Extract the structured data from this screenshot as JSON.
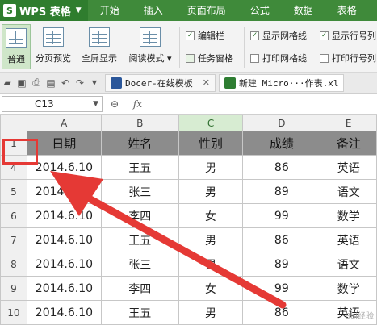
{
  "app": {
    "name": "WPS 表格",
    "logo": "S"
  },
  "menu": [
    "开始",
    "插入",
    "页面布局",
    "公式",
    "数据",
    "表格"
  ],
  "ribbon": {
    "buttons": [
      "普通",
      "分页预览",
      "全屏显示",
      "阅读模式"
    ],
    "reading_mode_arrow": "▾",
    "checkboxes": [
      {
        "label": "编辑栏",
        "checked": true
      },
      {
        "label": "任务窗格",
        "checked": false
      },
      {
        "label": "显示网格线",
        "checked": true
      },
      {
        "label": "打印网格线",
        "checked": false
      },
      {
        "label": "显示行号列",
        "checked": true
      },
      {
        "label": "打印行号列",
        "checked": false
      }
    ]
  },
  "tabs": [
    {
      "label": "Docer-在线模板",
      "icon_color": "#2b579a"
    },
    {
      "label": "新建 Micro···作表.xl",
      "icon_color": "#2e7d32"
    }
  ],
  "formula_bar": {
    "cell_ref": "C13",
    "fx": "fx"
  },
  "columns": [
    "A",
    "B",
    "C",
    "D",
    "E"
  ],
  "selected_column": "C",
  "header_row": {
    "row_num": "1",
    "cells": [
      "日期",
      "姓名",
      "性别",
      "成绩",
      "备注"
    ]
  },
  "rows": [
    {
      "num": "4",
      "cells": [
        "2014.6.10",
        "王五",
        "男",
        "86",
        "英语"
      ]
    },
    {
      "num": "5",
      "cells": [
        "2014.6.10",
        "张三",
        "男",
        "89",
        "语文"
      ]
    },
    {
      "num": "6",
      "cells": [
        "2014.6.10",
        "李四",
        "女",
        "99",
        "数学"
      ]
    },
    {
      "num": "7",
      "cells": [
        "2014.6.10",
        "王五",
        "男",
        "86",
        "英语"
      ]
    },
    {
      "num": "8",
      "cells": [
        "2014.6.10",
        "张三",
        "男",
        "89",
        "语文"
      ]
    },
    {
      "num": "9",
      "cells": [
        "2014.6.10",
        "李四",
        "女",
        "99",
        "数学"
      ]
    },
    {
      "num": "10",
      "cells": [
        "2014.6.10",
        "王五",
        "男",
        "86",
        "英语"
      ]
    }
  ],
  "watermark": "Bai经验",
  "colors": {
    "accent": "#3f8a3a",
    "annotation": "#e53935",
    "header_fill": "#8c8c8c"
  }
}
